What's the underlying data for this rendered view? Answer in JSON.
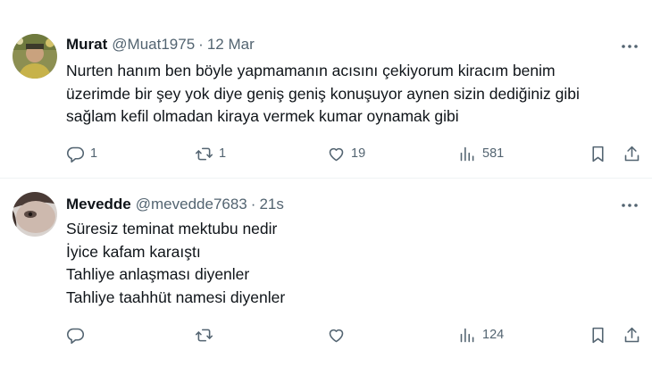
{
  "tweets": [
    {
      "name": "Murat",
      "handle": "@Muat1975",
      "separator": "·",
      "time": "12 Mar",
      "text_lines": [
        "Nurten hanım ben böyle yapmamanın acısını çekiyorum kiracım benim",
        "üzerimde bir şey yok diye geniş geniş konuşuyor aynen sizin dediğiniz gibi",
        "sağlam kefil olmadan kiraya vermek kumar oynamak gibi"
      ],
      "stats": {
        "replies": "1",
        "retweets": "1",
        "likes": "19",
        "views": "581"
      }
    },
    {
      "name": "Mevedde",
      "handle": "@mevedde7683",
      "separator": "·",
      "time": "21s",
      "text_lines": [
        "Süresiz teminat mektubu nedir",
        "İyice kafam karaıştı",
        "Tahliye anlaşması diyenler",
        "Tahliye taahhüt namesi diyenler"
      ],
      "stats": {
        "replies": "",
        "retweets": "",
        "likes": "",
        "views": "124"
      }
    }
  ],
  "icons": {
    "more": "more-horizontal-icon",
    "reply": "reply-icon",
    "retweet": "retweet-icon",
    "like": "heart-icon",
    "views": "views-chart-icon",
    "bookmark": "bookmark-icon",
    "share": "share-icon"
  },
  "colors": {
    "text": "#0f1419",
    "secondary": "#536471",
    "divider": "#eff3f4"
  }
}
